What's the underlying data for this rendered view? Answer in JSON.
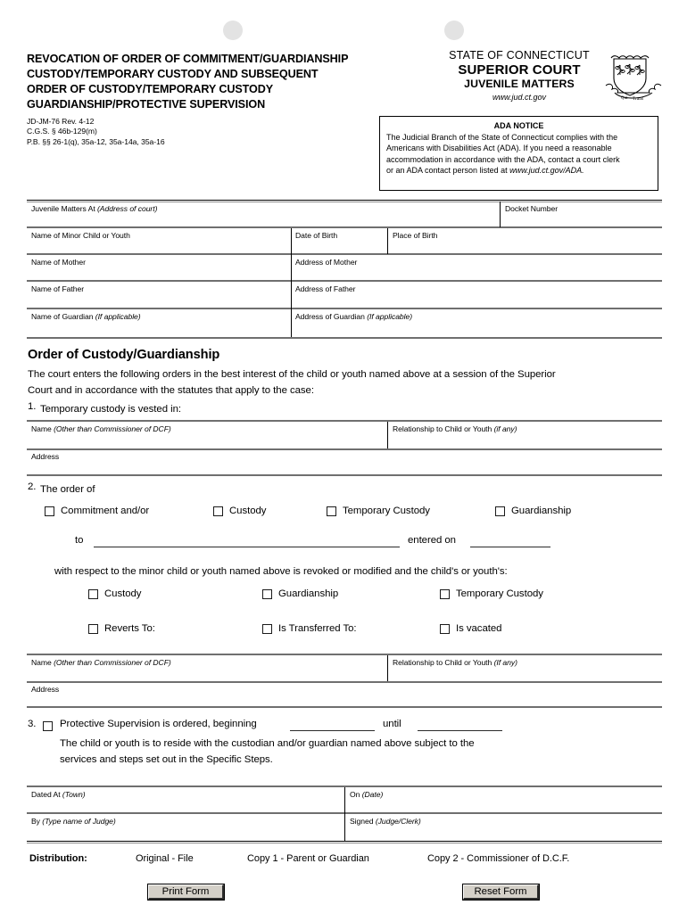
{
  "header": {
    "title_lines": [
      "REVOCATION OF ORDER OF COMMITMENT/GUARDIANSHIP",
      "CUSTODY/TEMPORARY CUSTODY AND SUBSEQUENT",
      "ORDER OF CUSTODY/TEMPORARY CUSTODY",
      "GUARDIANSHIP/PROTECTIVE SUPERVISION"
    ],
    "form_number": "JD-JM-76   Rev. 4-12",
    "statute_cgs": "C.G.S. § 46b-129(m)",
    "statute_pb": "P.B.  §§ 26-1(q), 35a-12, 35a-14a, 35a-16",
    "state_line": "STATE OF CONNECTICUT",
    "court_line": "SUPERIOR COURT",
    "division_line": "JUVENILE MATTERS",
    "website": "www.jud.ct.gov"
  },
  "ada": {
    "title": "ADA NOTICE",
    "line1": "The Judicial Branch of the State of Connecticut complies with the",
    "line2": "Americans with Disabilities Act (ADA). If you need a reasonable",
    "line3": "accommodation in accordance with the ADA, contact a court clerk",
    "line4_prefix": "or an ADA contact person listed at ",
    "line4_italic": "www.jud.ct.gov/ADA."
  },
  "case_table": {
    "court_address_label": "Juvenile Matters At",
    "court_address_hint": "(Address of court)",
    "docket_label": "Docket Number",
    "child_name_label": "Name of Minor Child or Youth",
    "dob_label": "Date of Birth",
    "pob_label": "Place of Birth",
    "mother_name_label": "Name of Mother",
    "mother_address_label": "Address of Mother",
    "father_name_label": "Name of Father",
    "father_address_label": "Address of Father",
    "guardian_name_label": "Name of Guardian",
    "guardian_name_hint": "(If applicable)",
    "guardian_address_label": "Address of Guardian",
    "guardian_address_hint": "(If applicable)"
  },
  "order_section": {
    "heading": "Order of Custody/Guardianship",
    "intro_line1": "The court enters the following orders in the best interest of the child or youth named above at a session of the Superior",
    "intro_line2": "Court and in accordance with the statutes that apply to the case:",
    "item1_number": "1.",
    "item1_text": "Temporary custody is vested in:"
  },
  "vested_block": {
    "name_label": "Name",
    "name_hint": "(Other than Commissioner of DCF)",
    "relationship_label": "Relationship to Child or Youth",
    "relationship_hint": "(if any)",
    "address_label": "Address"
  },
  "item2": {
    "number": "2.",
    "text": "The order of",
    "checkboxes": [
      {
        "label": "Commitment and/or"
      },
      {
        "label": "Custody"
      },
      {
        "label": "Temporary Custody"
      },
      {
        "label": "Guardianship"
      }
    ],
    "to_label": "to",
    "entered_on_label": "entered on",
    "respect_text": "with respect to the minor child or youth named above is revoked or modified and the child's or youth's:",
    "status_checkboxes": [
      {
        "label": "Custody"
      },
      {
        "label": "Guardianship"
      },
      {
        "label": "Temporary Custody"
      }
    ],
    "action_checkboxes": [
      {
        "label": "Reverts To:"
      },
      {
        "label": "Is Transferred To:"
      },
      {
        "label": "Is vacated"
      }
    ]
  },
  "transfer_block": {
    "name_label": "Name",
    "name_hint": "(Other than Commissioner of DCF)",
    "relationship_label": "Relationship to Child or Youth",
    "relationship_hint": "(If any)",
    "address_label": "Address"
  },
  "item3": {
    "number": "3.",
    "text_before": "Protective Supervision is ordered, beginning",
    "until_label": "until",
    "line2": "The child or youth is to reside with the custodian and/or guardian named above subject to the",
    "line3": "services and steps set out in the Specific Steps."
  },
  "signature_block": {
    "dated_at_label": "Dated At",
    "dated_at_hint": "(Town)",
    "on_label": "On",
    "on_hint": "(Date)",
    "by_label": "By",
    "by_hint": "(Type name of Judge)",
    "signed_label": "Signed",
    "signed_hint": "(Judge/Clerk)"
  },
  "distribution": {
    "label": "Distribution:",
    "items": [
      "Original - File",
      "Copy 1 - Parent or Guardian",
      "Copy 2 - Commissioner of D.C.F."
    ]
  },
  "buttons": {
    "print": "Print Form",
    "reset": "Reset Form"
  }
}
